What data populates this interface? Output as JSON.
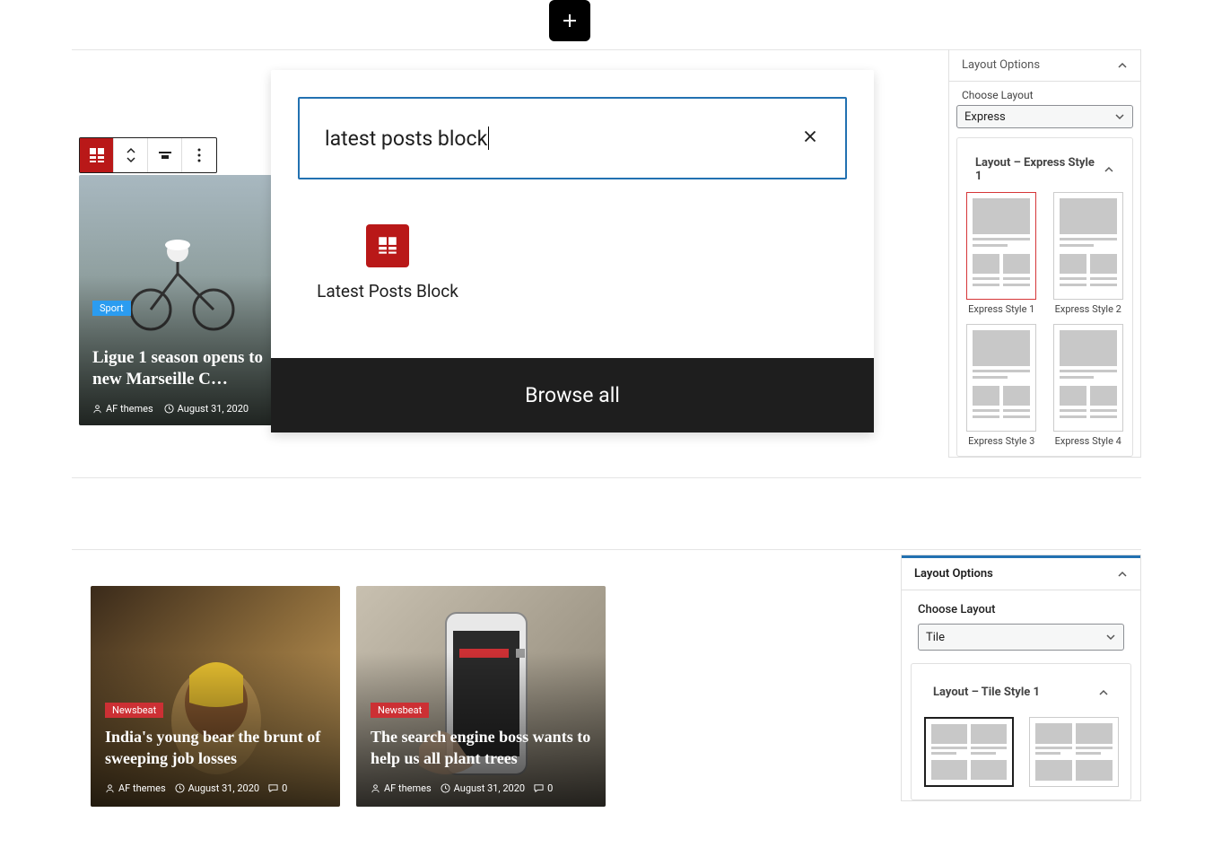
{
  "inserter": {
    "search_value": "latest posts block",
    "result_label": "Latest Posts Block",
    "browse_all": "Browse all"
  },
  "toolbar": {
    "block_icon": "grid-icon",
    "move_icon": "move-updown-icon",
    "align_icon": "align-icon",
    "more_icon": "more-vertical-icon"
  },
  "post1": {
    "tag": "Sport",
    "title": "Ligue 1 season opens to new Marseille C…",
    "author": "AF themes",
    "date": "August 31, 2020"
  },
  "sidebar1": {
    "layout_options": "Layout Options",
    "choose_layout": "Choose Layout",
    "layout_value": "Express",
    "style_header": "Layout – Express Style 1",
    "styles": [
      "Express Style 1",
      "Express Style 2",
      "Express Style 3",
      "Express Style 4"
    ]
  },
  "tiles": [
    {
      "tag": "Newsbeat",
      "title": "India's young bear the brunt of sweeping job losses",
      "author": "AF themes",
      "date": "August 31, 2020",
      "comments": "0"
    },
    {
      "tag": "Newsbeat",
      "title": "The search engine boss wants to help us all plant trees",
      "author": "AF themes",
      "date": "August 31, 2020",
      "comments": "0"
    }
  ],
  "sidebar2": {
    "layout_options": "Layout Options",
    "choose_layout": "Choose Layout",
    "layout_value": "Tile",
    "style_header": "Layout – Tile Style 1"
  }
}
